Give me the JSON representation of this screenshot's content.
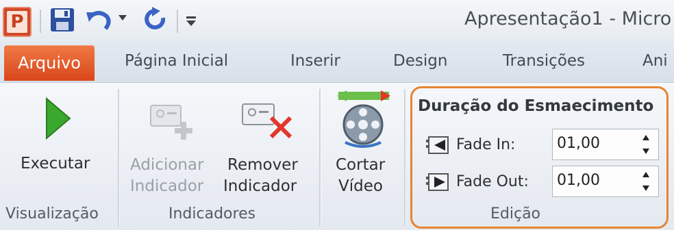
{
  "titlebar": {
    "app_letter": "P",
    "title": "Apresentação1 - Micro"
  },
  "tabs": {
    "file": "Arquivo",
    "items": [
      "Página Inicial",
      "Inserir",
      "Design",
      "Transições",
      "Ani"
    ]
  },
  "groups": {
    "visualizacao": {
      "play_label": "Executar",
      "group_label": "Visualização"
    },
    "indicadores": {
      "add_line1": "Adicionar",
      "add_line2": "Indicador",
      "remove_line1": "Remover",
      "remove_line2": "Indicador",
      "group_label": "Indicadores"
    },
    "cortar": {
      "line1": "Cortar",
      "line2": "Vídeo"
    },
    "edicao": {
      "title": "Duração do Esmaecimento",
      "fade_in_label": "Fade In:",
      "fade_in_value": "01,00",
      "fade_out_label": "Fade Out:",
      "fade_out_value": "01,00",
      "group_label": "Edição"
    }
  },
  "colors": {
    "file_tab": "#d9461b",
    "highlight": "#e6852f",
    "play": "#3aa82e"
  }
}
